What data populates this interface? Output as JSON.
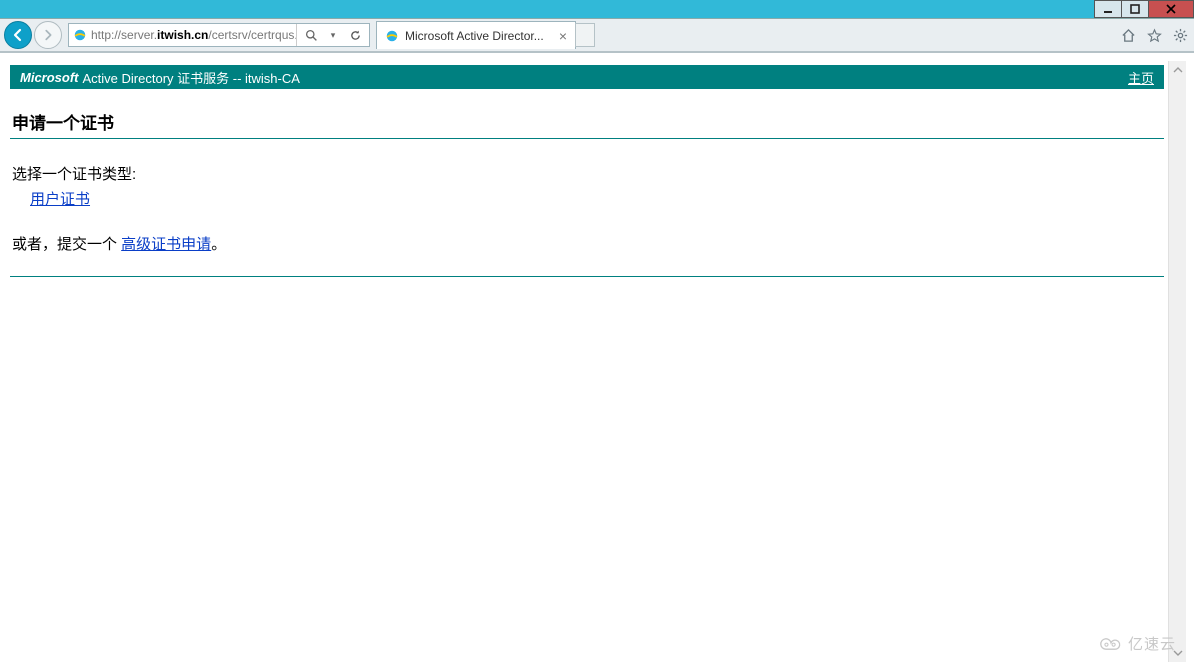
{
  "window": {
    "minimize": "–",
    "maximize": "□",
    "close": "x"
  },
  "nav": {
    "url_prefix": "http://server.",
    "url_domain": "itwish.cn",
    "url_suffix": "/certsrv/certrqus.a",
    "tab_title": "Microsoft Active Director..."
  },
  "banner": {
    "brand": "Microsoft",
    "service": " Active Directory 证书服务  --  itwish-CA",
    "home": "主页"
  },
  "page": {
    "title": "申请一个证书",
    "select_label": "选择一个证书类型:",
    "user_cert": "用户证书",
    "or_prefix": "或者，提交一个 ",
    "advanced_link": "高级证书申请",
    "or_suffix": "。"
  },
  "watermark": "亿速云"
}
